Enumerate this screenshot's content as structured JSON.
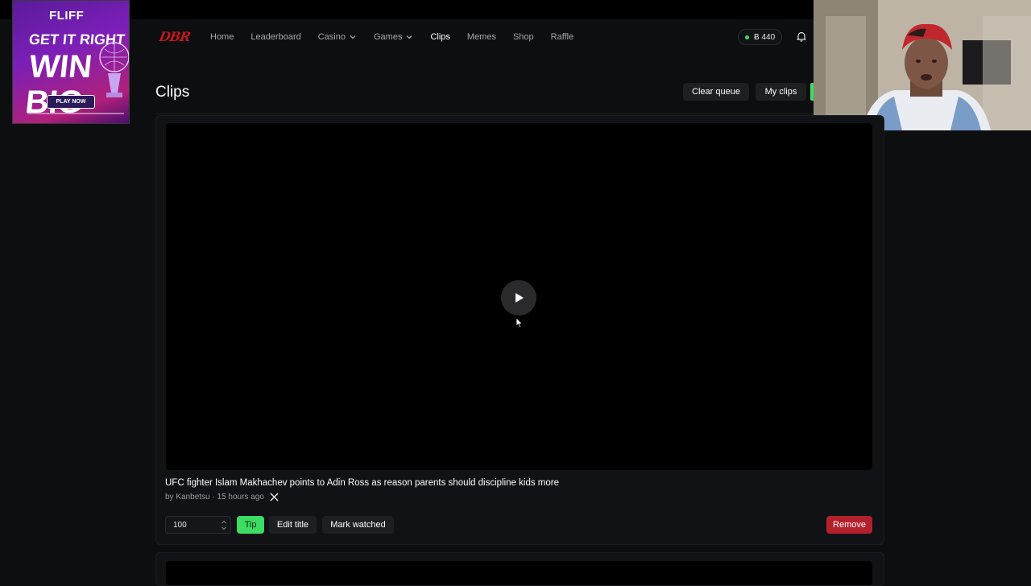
{
  "header": {
    "logo": "DBR",
    "nav": [
      {
        "label": "Home"
      },
      {
        "label": "Leaderboard"
      },
      {
        "label": "Casino"
      },
      {
        "label": "Games"
      },
      {
        "label": "Clips"
      },
      {
        "label": "Memes"
      },
      {
        "label": "Shop"
      },
      {
        "label": "Raffle"
      }
    ],
    "balance": "Ƀ 440"
  },
  "ad": {
    "brand": "FLIFF",
    "line1": "GET IT RIGHT",
    "line2": "WIN BIG",
    "cta": "PLAY NOW"
  },
  "page": {
    "title": "Clips",
    "clear_queue": "Clear queue",
    "my_clips": "My clips"
  },
  "clip": {
    "title": "UFC fighter Islam Makhachev points to Adin Ross as reason parents should discipline kids more",
    "meta": "by Kanbetsu · 15 hours ago",
    "tip_amount": "100",
    "tip_label": "Tip",
    "edit_title_label": "Edit title",
    "mark_watched_label": "Mark watched",
    "remove_label": "Remove"
  },
  "colors": {
    "accent_green": "#3ddc63",
    "danger_red": "#b3202b",
    "logo_red": "#c4161c",
    "background": "#0d0e10"
  }
}
